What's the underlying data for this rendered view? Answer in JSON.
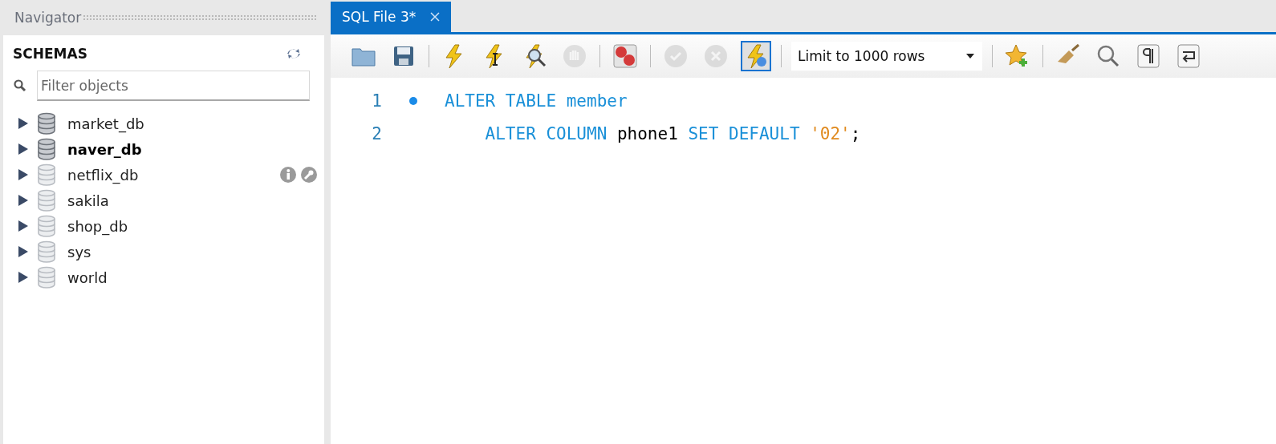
{
  "navigator": {
    "title": "Navigator",
    "section": "SCHEMAS",
    "filter": {
      "placeholder": "Filter objects"
    },
    "schemas": [
      {
        "name": "market_db",
        "loaded": true,
        "default": false,
        "hovered": false
      },
      {
        "name": "naver_db",
        "loaded": true,
        "default": true,
        "hovered": false
      },
      {
        "name": "netflix_db",
        "loaded": false,
        "default": false,
        "hovered": true
      },
      {
        "name": "sakila",
        "loaded": false,
        "default": false,
        "hovered": false
      },
      {
        "name": "shop_db",
        "loaded": false,
        "default": false,
        "hovered": false
      },
      {
        "name": "sys",
        "loaded": false,
        "default": false,
        "hovered": false
      },
      {
        "name": "world",
        "loaded": false,
        "default": false,
        "hovered": false
      }
    ]
  },
  "tabs": [
    {
      "label": "SQL File 3*",
      "selected": true
    }
  ],
  "toolbar": [
    {
      "kind": "open",
      "disabled": false,
      "pressed": false
    },
    {
      "kind": "save",
      "disabled": false,
      "pressed": false
    },
    {
      "kind": "sep"
    },
    {
      "kind": "execute",
      "disabled": false,
      "pressed": false
    },
    {
      "kind": "execute-current",
      "disabled": false,
      "pressed": false
    },
    {
      "kind": "explain",
      "disabled": false,
      "pressed": false
    },
    {
      "kind": "stop",
      "disabled": true,
      "pressed": false
    },
    {
      "kind": "sep"
    },
    {
      "kind": "error-stop",
      "disabled": false,
      "pressed": false
    },
    {
      "kind": "sep"
    },
    {
      "kind": "commit",
      "disabled": true,
      "pressed": false
    },
    {
      "kind": "rollback",
      "disabled": true,
      "pressed": false
    },
    {
      "kind": "autocommit",
      "disabled": false,
      "pressed": true
    },
    {
      "kind": "sep"
    },
    {
      "kind": "limit",
      "value": "Limit to 1000 rows"
    },
    {
      "kind": "sep"
    },
    {
      "kind": "snippet",
      "disabled": false,
      "pressed": false
    },
    {
      "kind": "sep"
    },
    {
      "kind": "beautify",
      "disabled": false,
      "pressed": false
    },
    {
      "kind": "find",
      "disabled": false,
      "pressed": false
    },
    {
      "kind": "invisibles",
      "disabled": false,
      "pressed": false
    },
    {
      "kind": "wrap",
      "disabled": false,
      "pressed": false
    }
  ],
  "editor": {
    "lines": [
      {
        "number": "1",
        "marker": true,
        "tokens": [
          {
            "kind": "keyword",
            "text": "ALTER TABLE"
          },
          {
            "kind": "ident",
            "text": " member"
          }
        ]
      },
      {
        "number": "2",
        "marker": false,
        "tokens": [
          {
            "kind": "keyword",
            "text": "    ALTER COLUMN"
          },
          {
            "kind": "plain",
            "text": " phone1 "
          },
          {
            "kind": "keyword",
            "text": "SET DEFAULT"
          },
          {
            "kind": "string",
            "text": " '02'"
          },
          {
            "kind": "plain",
            "text": ";"
          }
        ]
      }
    ]
  }
}
